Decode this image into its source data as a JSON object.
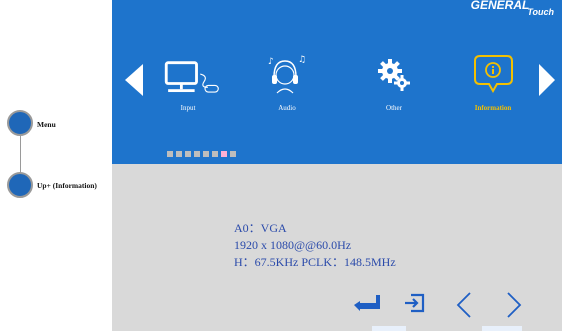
{
  "side_panel": {
    "step1_label": "Menu",
    "step2_label": "Up+ (Information)"
  },
  "osd": {
    "brand_main": "GENERAL",
    "brand_sub": "Touch",
    "menu_items": [
      {
        "label": "Input",
        "icon": "monitor-mouse-icon",
        "selected": false
      },
      {
        "label": "Audio",
        "icon": "headphones-icon",
        "selected": false
      },
      {
        "label": "Other",
        "icon": "gears-icon",
        "selected": false
      },
      {
        "label": "Information",
        "icon": "info-bubble-icon",
        "selected": true
      }
    ],
    "page_dots": {
      "count": 8,
      "active_index": 6
    },
    "info": {
      "line1": "A0：VGA",
      "line2": "1920 x 1080@@60.0Hz",
      "line3": "H：67.5KHz  PCLK：148.5MHz"
    },
    "controls": [
      "enter-icon",
      "exit-icon",
      "chevron-left-icon",
      "chevron-right-icon"
    ],
    "colors": {
      "top_bg": "#1e74cc",
      "bottom_bg": "#d9d9d9",
      "selected": "#f3c000",
      "info_text": "#2a4aaa"
    }
  }
}
